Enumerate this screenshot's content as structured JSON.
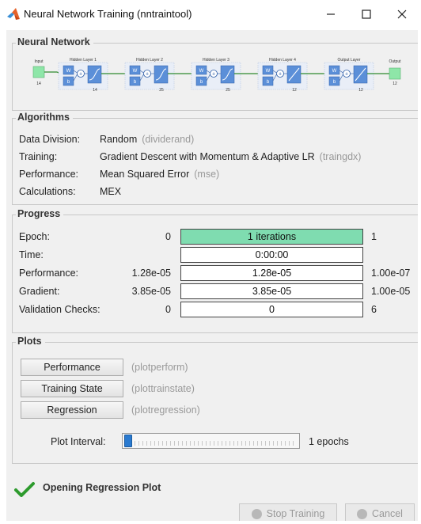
{
  "window": {
    "title": "Neural Network Training (nntraintool)",
    "controls": {
      "minimize": "minimize-icon",
      "maximize": "maximize-icon",
      "close": "close-icon"
    }
  },
  "neural_network": {
    "title": "Neural Network",
    "input": {
      "label": "Input",
      "size": "14"
    },
    "layers": [
      {
        "label": "Hidden Layer 1",
        "size": "14",
        "transfer": "tansig"
      },
      {
        "label": "Hidden Layer 2",
        "size": "25",
        "transfer": "tansig"
      },
      {
        "label": "Hidden Layer 3",
        "size": "25",
        "transfer": "tansig"
      },
      {
        "label": "Hidden Layer 4",
        "size": "12",
        "transfer": "purelin"
      },
      {
        "label": "Output Layer",
        "size": "12",
        "transfer": "purelin"
      }
    ],
    "output": {
      "label": "Output",
      "size": "12"
    },
    "weight_label": "W",
    "bias_label": "b",
    "sum_label": "+"
  },
  "algorithms": {
    "title": "Algorithms",
    "rows": [
      {
        "label": "Data Division:",
        "value": "Random",
        "fn": "(dividerand)"
      },
      {
        "label": "Training:",
        "value": "Gradient Descent with Momentum & Adaptive LR",
        "fn": "(traingdx)"
      },
      {
        "label": "Performance:",
        "value": "Mean Squared Error",
        "fn": "(mse)"
      },
      {
        "label": "Calculations:",
        "value": "MEX",
        "fn": ""
      }
    ]
  },
  "progress": {
    "title": "Progress",
    "rows": [
      {
        "label": "Epoch:",
        "start": "0",
        "current": "1 iterations",
        "end": "1",
        "fill": 1.0
      },
      {
        "label": "Time:",
        "start": "",
        "current": "0:00:00",
        "end": "",
        "fill": 0
      },
      {
        "label": "Performance:",
        "start": "1.28e-05",
        "current": "1.28e-05",
        "end": "1.00e-07",
        "fill": 0
      },
      {
        "label": "Gradient:",
        "start": "3.85e-05",
        "current": "3.85e-05",
        "end": "1.00e-05",
        "fill": 0
      },
      {
        "label": "Validation Checks:",
        "start": "0",
        "current": "0",
        "end": "6",
        "fill": 0
      }
    ]
  },
  "plots": {
    "title": "Plots",
    "buttons": [
      {
        "label": "Performance",
        "fn": "(plotperform)"
      },
      {
        "label": "Training State",
        "fn": "(plottrainstate)"
      },
      {
        "label": "Regression",
        "fn": "(plotregression)"
      }
    ],
    "interval_label": "Plot Interval:",
    "interval_value": "1 epochs",
    "slider_level": 0
  },
  "status": {
    "icon": "checkmark-icon",
    "text": "Opening Regression Plot"
  },
  "buttons": {
    "stop_training": "Stop Training",
    "cancel": "Cancel"
  },
  "colors": {
    "progress_fill": "#7fdcb0",
    "node_input_output": "#8ee6a8",
    "layer_box": "#5b8fd8",
    "layer_inner": "#ffffff",
    "check": "#2e9b2e",
    "slider_thumb": "#2a7ad0"
  }
}
